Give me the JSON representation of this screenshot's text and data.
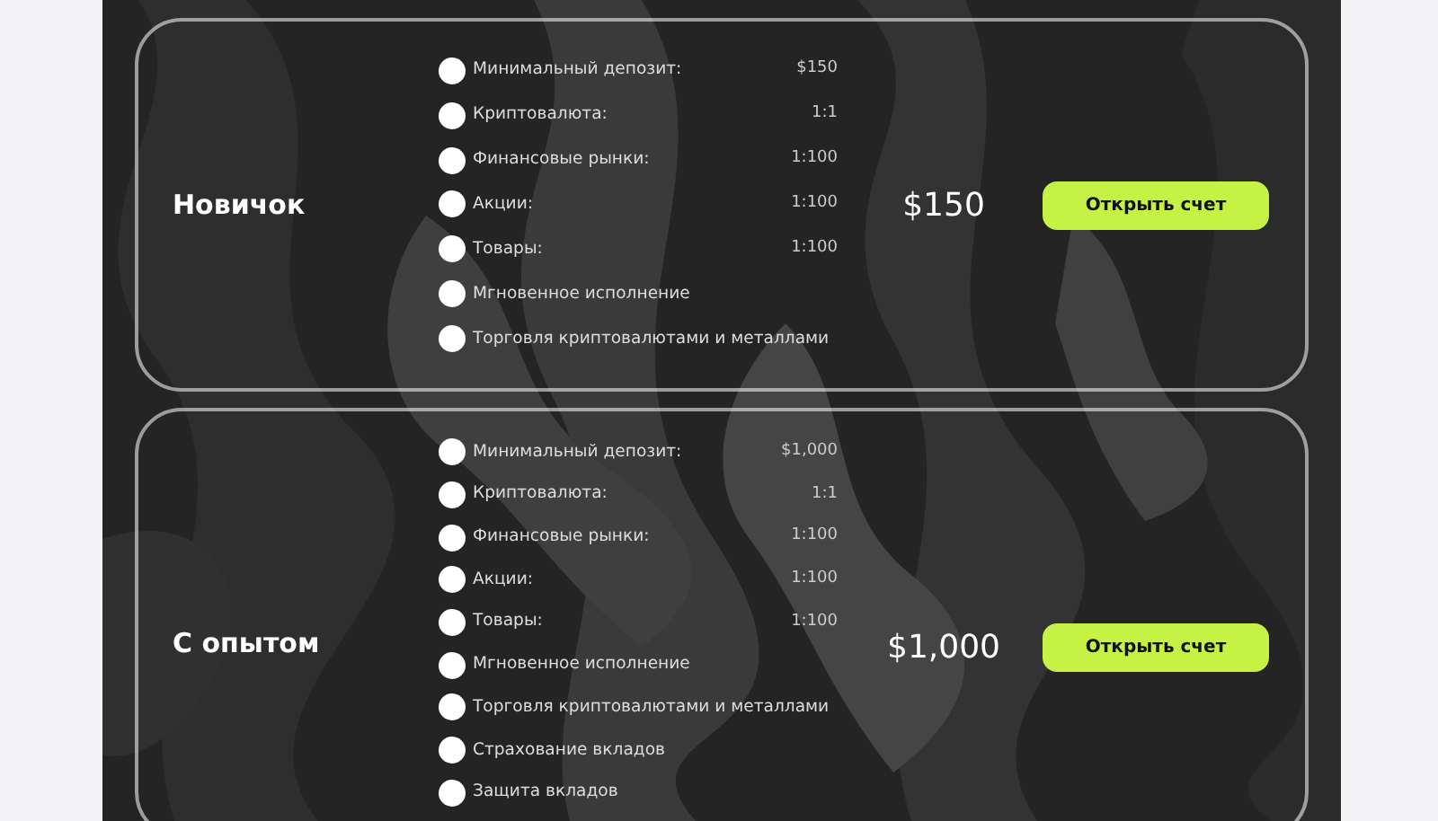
{
  "plans": [
    {
      "name": "Новичок",
      "price": "$150",
      "button": "Открыть счет",
      "features": [
        {
          "label": "Минимальный депозит:",
          "value": "$150"
        },
        {
          "label": "Криптовалюта:",
          "value": "1:1"
        },
        {
          "label": "Финансовые рынки:",
          "value": "1:100"
        },
        {
          "label": "Акции:",
          "value": "1:100"
        },
        {
          "label": "Товары:",
          "value": "1:100"
        },
        {
          "label": "Мгновенное исполнение"
        },
        {
          "label": "Торговля криптовалютами и металлами"
        }
      ]
    },
    {
      "name": "С опытом",
      "price": "$1,000",
      "button": "Открыть счет",
      "features": [
        {
          "label": "Минимальный депозит:",
          "value": "$1,000"
        },
        {
          "label": "Криптовалюта:",
          "value": "1:1"
        },
        {
          "label": "Финансовые рынки:",
          "value": "1:100"
        },
        {
          "label": "Акции:",
          "value": "1:100"
        },
        {
          "label": "Товары:",
          "value": "1:100"
        },
        {
          "label": "Мгновенное исполнение"
        },
        {
          "label": "Торговля криптовалютами и металлами"
        },
        {
          "label": "Страхование вкладов"
        },
        {
          "label": "Защита вкладов"
        }
      ]
    }
  ]
}
